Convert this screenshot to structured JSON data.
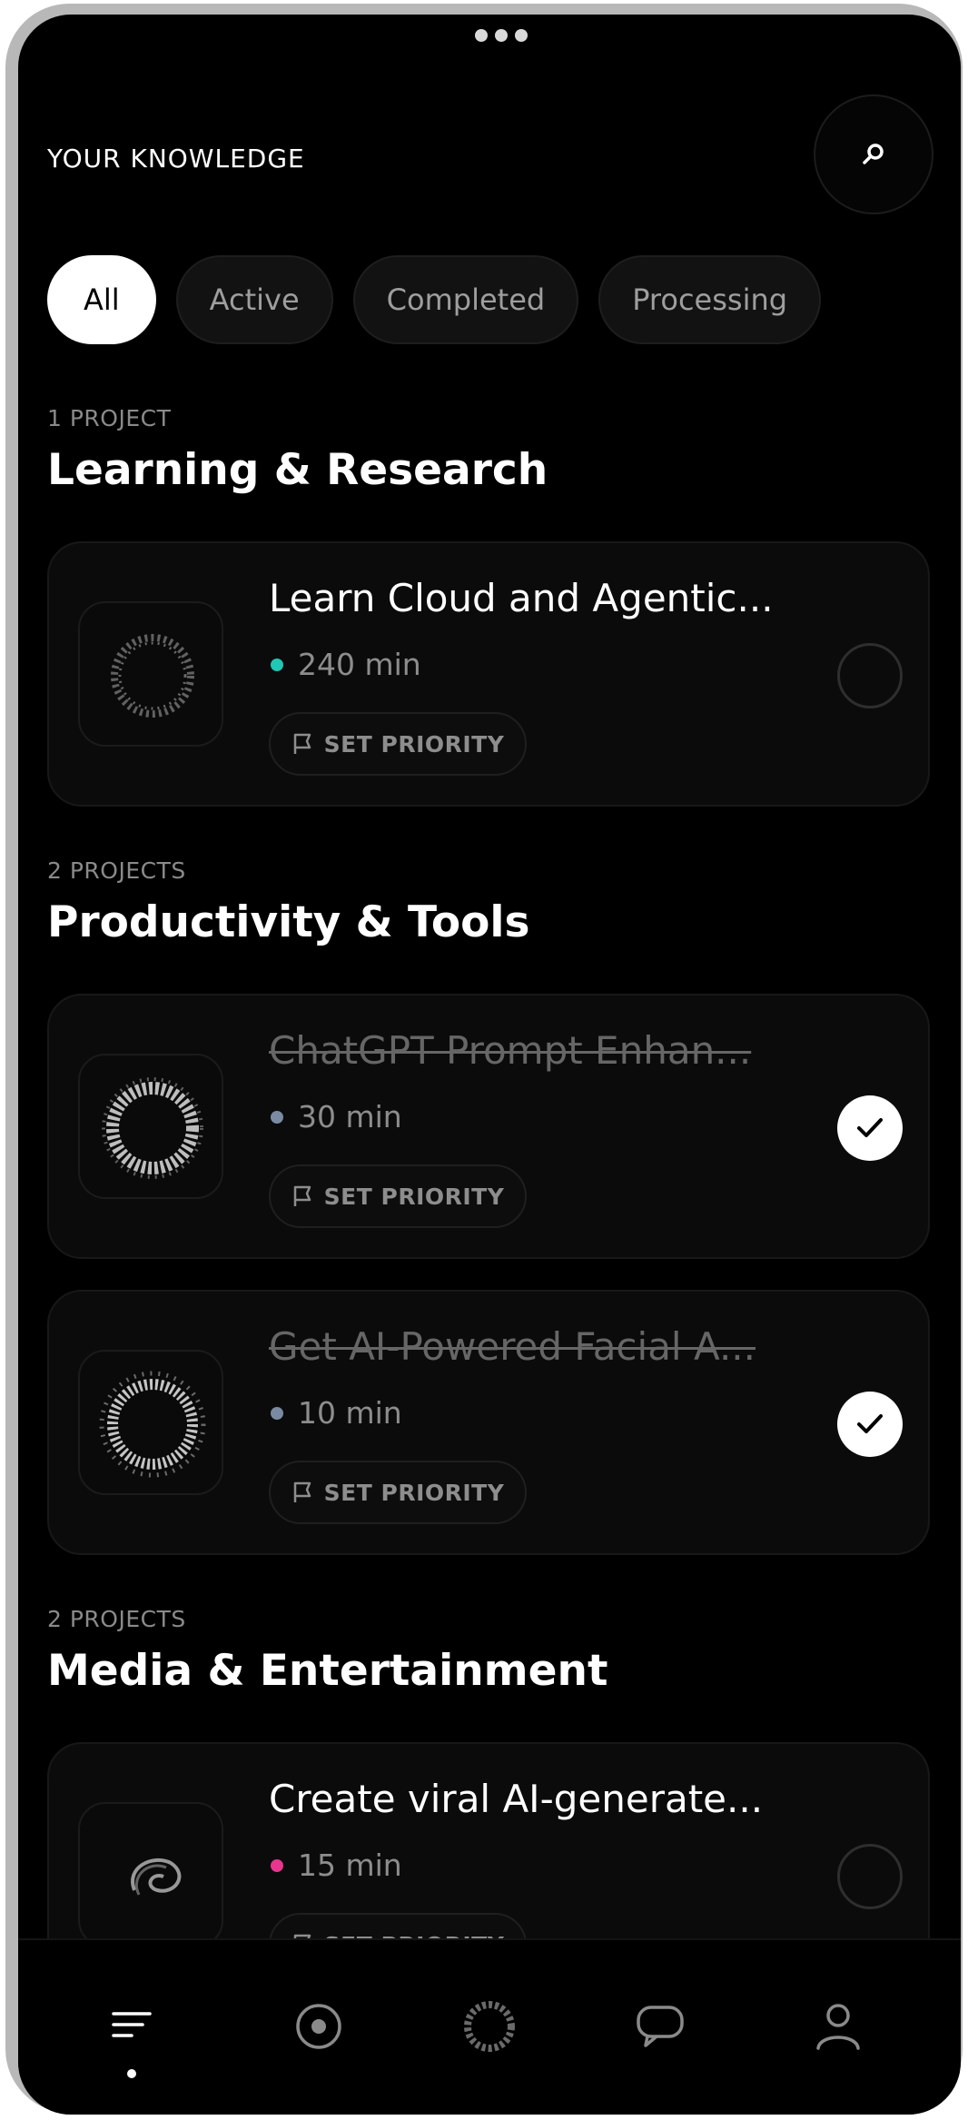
{
  "header": {
    "title": "YOUR KNOWLEDGE",
    "search_icon": "search-icon"
  },
  "filters": [
    {
      "label": "All",
      "selected": true
    },
    {
      "label": "Active",
      "selected": false
    },
    {
      "label": "Completed",
      "selected": false
    },
    {
      "label": "Processing",
      "selected": false
    }
  ],
  "groups": [
    {
      "count": "1 PROJECT",
      "title": "Learning & Research",
      "items": [
        {
          "title": "Learn Cloud and Agentic...",
          "duration": "240 min",
          "dot_color": "#1fc7b4",
          "priority": "SET PRIORITY",
          "completed": false
        }
      ]
    },
    {
      "count": "2 PROJECTS",
      "title": "Productivity & Tools",
      "items": [
        {
          "title": "ChatGPT Prompt Enhan...",
          "duration": "30 min",
          "dot_color": "#7a8aa3",
          "priority": "SET PRIORITY",
          "completed": true
        },
        {
          "title": "Get AI-Powered Facial A...",
          "duration": "10 min",
          "dot_color": "#7a8aa3",
          "priority": "SET PRIORITY",
          "completed": true
        }
      ]
    },
    {
      "count": "2 PROJECTS",
      "title": "Media & Entertainment",
      "items": [
        {
          "title": "Create viral AI-generate...",
          "duration": "15 min",
          "dot_color": "#e8368f",
          "priority": "SET PRIORITY",
          "completed": false
        }
      ]
    }
  ],
  "nav": [
    "list-icon",
    "target-icon",
    "swirl-logo-icon",
    "chat-bubble-icon",
    "profile-icon"
  ]
}
